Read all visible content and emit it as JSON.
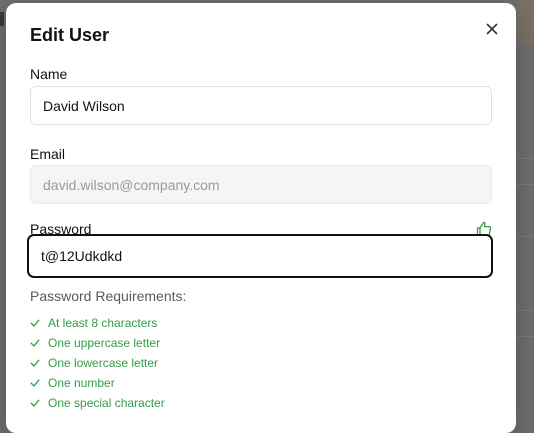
{
  "dialog": {
    "title": "Edit User",
    "close_icon": "close-icon"
  },
  "fields": {
    "name": {
      "label": "Name",
      "value": "David Wilson"
    },
    "email": {
      "label": "Email",
      "value": "david.wilson@company.com",
      "disabled": true
    },
    "password": {
      "label": "Password",
      "value": "t@12Udkdkd",
      "strength_icon": "thumbs-up-icon"
    }
  },
  "requirements": {
    "title": "Password Requirements:",
    "items": [
      {
        "label": "At least 8 characters",
        "met": true
      },
      {
        "label": "One uppercase letter",
        "met": true
      },
      {
        "label": "One lowercase letter",
        "met": true
      },
      {
        "label": "One number",
        "met": true
      },
      {
        "label": "One special character",
        "met": true
      }
    ]
  },
  "colors": {
    "success": "#2f9e44",
    "focus_border": "#111111",
    "overlay": "#6f6f6f"
  }
}
